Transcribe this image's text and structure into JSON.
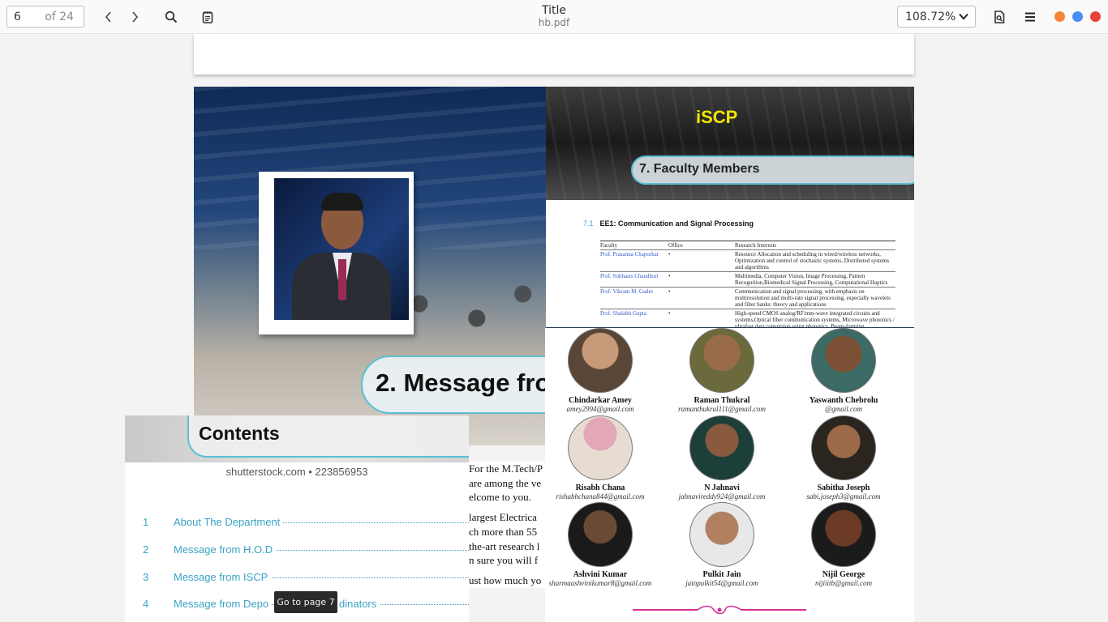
{
  "toolbar": {
    "page_number": "6",
    "page_count": "of 24",
    "title": "Title",
    "filename": "hb.pdf",
    "zoom": "108.72%",
    "icons": [
      "chevron-left-icon",
      "chevron-right-icon",
      "search-icon",
      "annotations-icon",
      "document-properties-icon",
      "menu-icon"
    ],
    "window_controls": {
      "minimize_color": "#f5853b",
      "maximize_color": "#4a8df5",
      "close_color": "#e8413a"
    }
  },
  "message_page": {
    "banner": "2. Message fro"
  },
  "faculty_page": {
    "logo": "iSCP",
    "title": "7. Faculty Members",
    "section_number": "7.1",
    "section_title": "EE1: Communication and Signal Processing",
    "table": {
      "headers": [
        "Faculty",
        "Office",
        "Research Interests"
      ],
      "rows": [
        {
          "name": "Prof. Prasanna Chaporkar",
          "office": "•",
          "interests": "Resource Allocation and scheduling in wired/wireless networks, Optimization and control of stochastic systems, Distributed systems and algorithms"
        },
        {
          "name": "Prof. Subhasis Chaudhuri",
          "office": "•",
          "interests": "Multimedia, Computer Vision, Image Processing, Pattern Recognition,Biomedical Signal Processing, Computational Haptics"
        },
        {
          "name": "Prof. Vikram M. Gadre",
          "office": "•",
          "interests": "Communication and signal processing, with emphasis on multiresolution and multi-rate signal processing, especially wavelets and filter banks: theory and applications"
        },
        {
          "name": "Prof. Shalabh Gupta",
          "office": "•",
          "interests": "High-speed CMOS analog/RF/mm-wave integrated circuits and systems,Optical fiber communication systems, Microwave photonics / ultrafast data conversion using photonics, Beam-forming"
        }
      ]
    }
  },
  "students": [
    {
      "name": "Chindarkar Amey",
      "email": "amey2994@gmail.com"
    },
    {
      "name": "Raman Thukral",
      "email": "ramanthukral111@gmail.com"
    },
    {
      "name": "Yaswanth Chebrolu",
      "email": "@gmail.com"
    },
    {
      "name": "Risabh Chana",
      "email": "rishabhchana844@gmail.com"
    },
    {
      "name": "N Jahnavi",
      "email": "jahnavireddy924@gmail.com"
    },
    {
      "name": "Sabitha Joseph",
      "email": "sabi.joseph3@gmail.com"
    },
    {
      "name": "Ashvini Kumar",
      "email": "sharmaashvinikumar8@gmail.com"
    },
    {
      "name": "Pulkit Jain",
      "email": "jainpulkit54@gmail.com"
    },
    {
      "name": "Nijil George",
      "email": "nijiiitb@gmail.com"
    }
  ],
  "contents_page": {
    "title": "Contents",
    "watermark": "shutterstock.com • 223856953",
    "items": [
      {
        "number": "1",
        "label": "About The Department"
      },
      {
        "number": "2",
        "label": "Message from H.O.D"
      },
      {
        "number": "3",
        "label": "Message from ISCP"
      },
      {
        "number": "4",
        "label": "Message from Depo"
      },
      {
        "number": "",
        "label": "dinators"
      }
    ]
  },
  "body_text": [
    "For the M.Tech/P",
    "are among the ve",
    "elcome to you.",
    "",
    "largest Electrica",
    "ch more than 55",
    "the-art research l",
    "n sure you will f",
    "",
    "ust how much yo"
  ],
  "tooltip": "Go to page 7"
}
